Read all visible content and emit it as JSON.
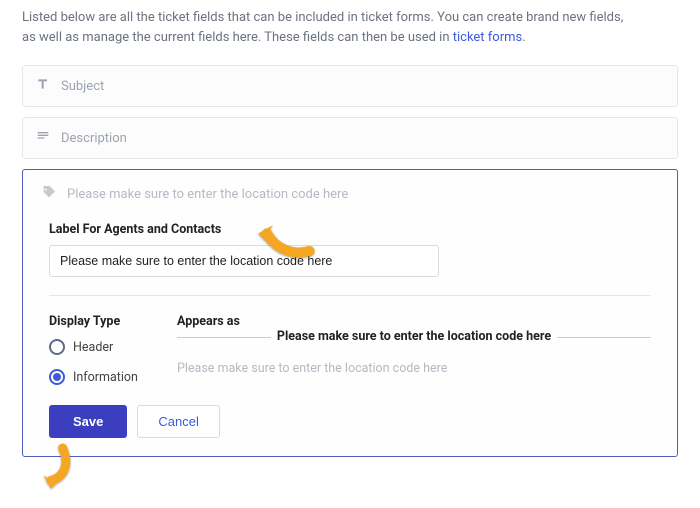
{
  "intro": {
    "line1": "Listed below are all the ticket fields that can be included in ticket forms. You can create brand new fields,",
    "line2": "as well as manage the current fields here. These fields can then be used in ",
    "link": "ticket forms",
    "period": "."
  },
  "fields": {
    "subject": "Subject",
    "description": "Description"
  },
  "editor": {
    "header_hint": "Please make sure to enter the location code here",
    "label_title": "Label For Agents and Contacts",
    "label_value": "Please make sure to enter the location code here",
    "display_type_title": "Display Type",
    "appears_as_title": "Appears as",
    "radio_header": "Header",
    "radio_information": "Information",
    "preview_bold": "Please make sure to enter the location code here",
    "preview_muted": "Please make sure to enter the location code here",
    "save": "Save",
    "cancel": "Cancel"
  }
}
